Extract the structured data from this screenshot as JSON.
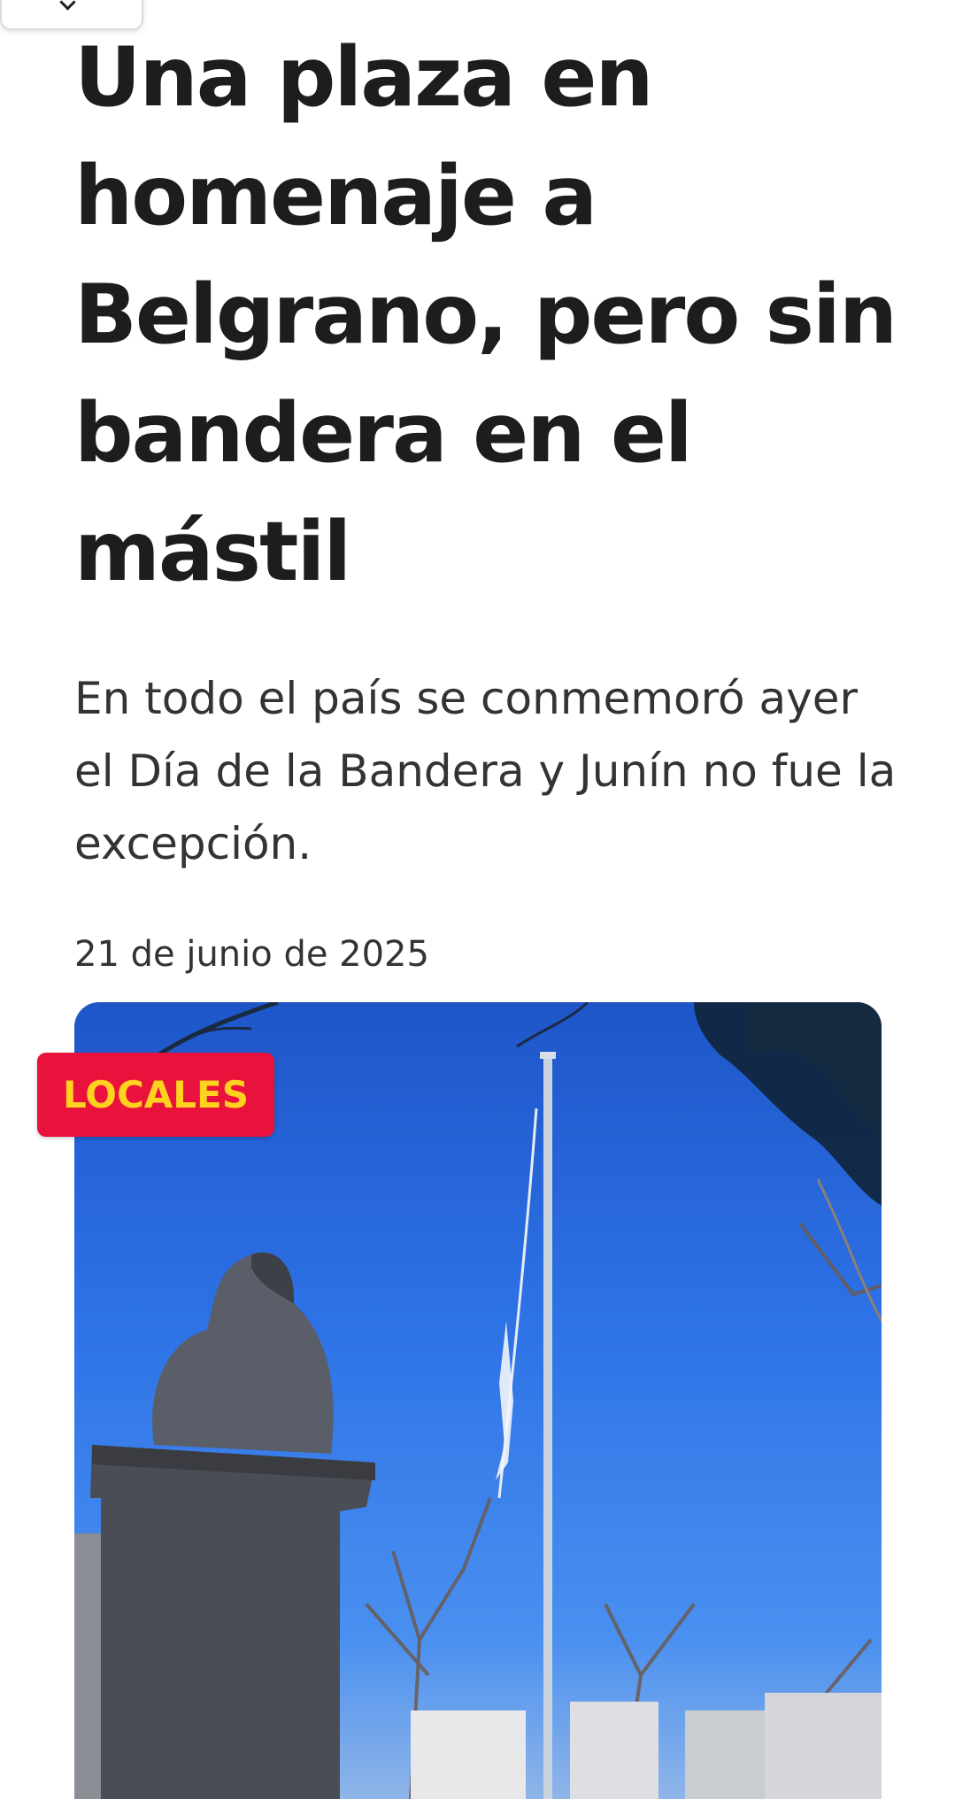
{
  "article": {
    "title": "Una plaza en homenaje a Belgrano, pero sin bandera en el mástil",
    "subtitle": "En todo el país se conmemoró ayer el Día de la Bandera y Junín no fue la excepción.",
    "date": "21 de junio de 2025",
    "category": "LOCALES"
  },
  "colors": {
    "badge_background": "#e8123c",
    "badge_text": "#ffd21f",
    "headline": "#1d1d1d",
    "body_text": "#333333"
  },
  "icons": {
    "top_handle": "chevron-down-icon"
  }
}
